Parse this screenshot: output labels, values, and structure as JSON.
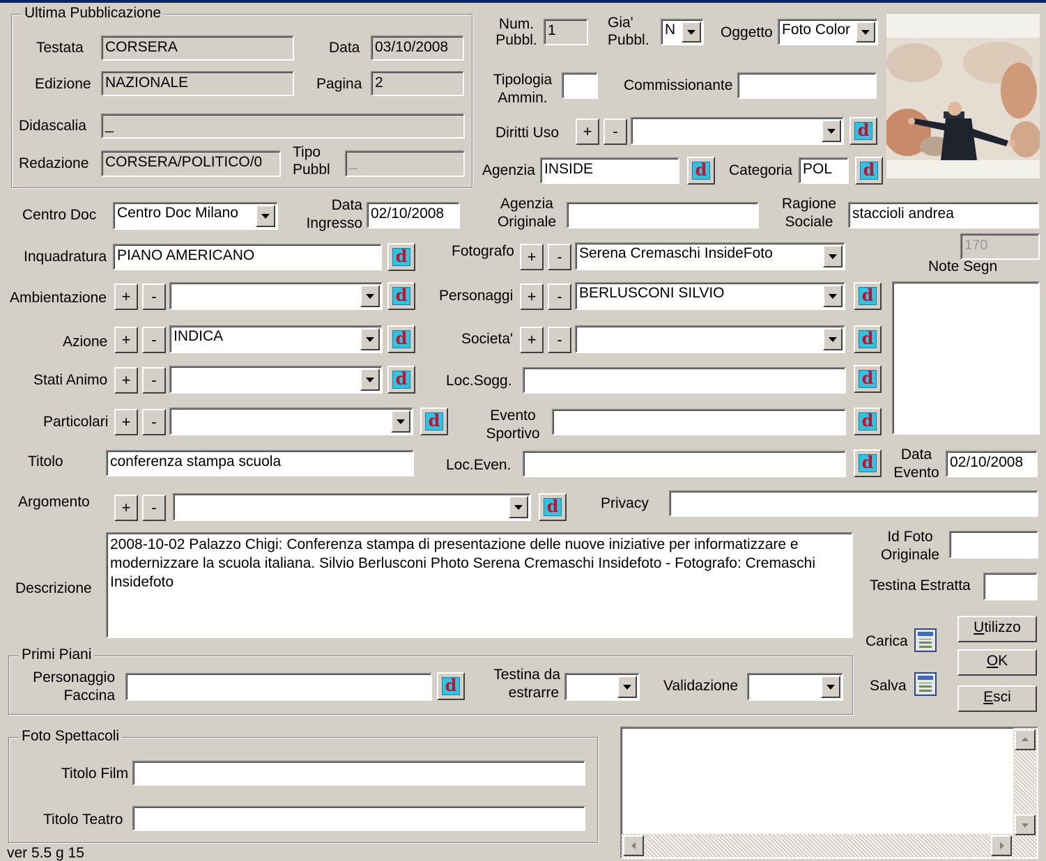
{
  "ultima_pubblicazione": {
    "title": "Ultima Pubblicazione",
    "testata": {
      "label": "Testata",
      "value": "CORSERA"
    },
    "data": {
      "label": "Data",
      "value": "03/10/2008"
    },
    "edizione": {
      "label": "Edizione",
      "value": "NAZIONALE"
    },
    "pagina": {
      "label": "Pagina",
      "value": "2"
    },
    "didascalia": {
      "label": "Didascalia",
      "value": "_"
    },
    "redazione": {
      "label": "Redazione",
      "value": "CORSERA/POLITICO/0"
    },
    "tipo_pubbl": {
      "label_line1": "Tipo",
      "label_line2": "Pubbl",
      "value": "_"
    }
  },
  "top": {
    "num_pubbl": {
      "label_line1": "Num.",
      "label_line2": "Pubbl.",
      "value": "1"
    },
    "gia_pubbl": {
      "label_line1": "Gia'",
      "label_line2": "Pubbl.",
      "value": "N"
    },
    "oggetto": {
      "label": "Oggetto",
      "value": "Foto Color"
    },
    "tipologia_ammin": {
      "label_line1": "Tipologia",
      "label_line2": "Ammin.",
      "value": ""
    },
    "commissionante": {
      "label": "Commissionante",
      "value": ""
    },
    "diritti_uso": {
      "label": "Diritti Uso",
      "value": ""
    },
    "agenzia": {
      "label": "Agenzia",
      "value": "INSIDE"
    },
    "categoria": {
      "label": "Categoria",
      "value": "POL"
    }
  },
  "centro_doc": {
    "label": "Centro Doc",
    "value": "Centro Doc Milano"
  },
  "data_ingresso": {
    "label_line1": "Data",
    "label_line2": "Ingresso",
    "value": "02/10/2008"
  },
  "agenzia_originale": {
    "label_line1": "Agenzia",
    "label_line2": "Originale",
    "value": ""
  },
  "ragione_sociale": {
    "label_line1": "Ragione",
    "label_line2": "Sociale",
    "value": "staccioli andrea"
  },
  "inquadratura": {
    "label": "Inquadratura",
    "value": "PIANO AMERICANO"
  },
  "ambientazione": {
    "label": "Ambientazione",
    "value": ""
  },
  "azione": {
    "label": "Azione",
    "value": "INDICA"
  },
  "stati_animo": {
    "label": "Stati Animo",
    "value": ""
  },
  "particolari": {
    "label": "Particolari",
    "value": ""
  },
  "titolo": {
    "label": "Titolo",
    "value": "conferenza stampa scuola"
  },
  "argomento": {
    "label": "Argomento",
    "value": ""
  },
  "fotografo": {
    "label": "Fotografo",
    "value": "Serena Cremaschi InsideFoto"
  },
  "personaggi": {
    "label": "Personaggi",
    "value": "BERLUSCONI SILVIO"
  },
  "societa": {
    "label": "Societa'",
    "value": ""
  },
  "loc_sogg": {
    "label": "Loc.Sogg.",
    "value": ""
  },
  "evento_sportivo": {
    "label_line1": "Evento",
    "label_line2": "Sportivo",
    "value": ""
  },
  "loc_even": {
    "label": "Loc.Even.",
    "value": ""
  },
  "data_evento": {
    "label_line1": "Data",
    "label_line2": "Evento",
    "value": "02/10/2008"
  },
  "privacy": {
    "label": "Privacy",
    "value": ""
  },
  "note_segn": {
    "label": "Note Segn",
    "counter": "170",
    "value": ""
  },
  "descrizione": {
    "label": "Descrizione",
    "value": "2008-10-02 Palazzo Chigi: Conferenza stampa di presentazione delle nuove iniziative per informatizzare e modernizzare la scuola italiana. Silvio Berlusconi Photo Serena Cremaschi Insidefoto - Fotografo: Cremaschi Insidefoto"
  },
  "id_foto_originale": {
    "label_line1": "Id Foto",
    "label_line2": "Originale",
    "value": ""
  },
  "testina_estratta": {
    "label": "Testina Estratta",
    "value": ""
  },
  "buttons": {
    "carica": "Carica",
    "salva": "Salva",
    "utilizzo": {
      "underlined": "U",
      "rest": "tilizzo"
    },
    "ok": {
      "underlined": "O",
      "rest": "K"
    },
    "esci": {
      "underlined": "E",
      "rest": "sci"
    },
    "plus": "+",
    "minus": "-",
    "dbutton_glyph": "d"
  },
  "primi_piani": {
    "title": "Primi Piani",
    "personaggio_faccina": {
      "label_line1": "Personaggio",
      "label_line2": "Faccina",
      "value": ""
    },
    "testina_da_estrarre": {
      "label_line1": "Testina da",
      "label_line2": "estrarre",
      "value": ""
    },
    "validazione": {
      "label": "Validazione",
      "value": ""
    }
  },
  "foto_spettacoli": {
    "title": "Foto Spettacoli",
    "titolo_film": {
      "label": "Titolo Film",
      "value": ""
    },
    "titolo_teatro": {
      "label": "Titolo Teatro",
      "value": ""
    }
  },
  "version": "ver 5.5 g 15",
  "icons": {
    "dbutton": "lookup-d-icon",
    "carica": "load-icon",
    "salva": "save-icon",
    "photo": "photo-thumbnail"
  },
  "colors": {
    "window": "#d4d0c8",
    "dbutton_bg": "#33c2e0",
    "dbutton_glyph": "#c8102e",
    "titlebar": "#0a246a"
  }
}
